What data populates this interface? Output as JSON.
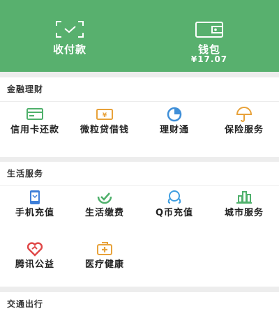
{
  "header": {
    "collect": {
      "label": "收付款",
      "icon": "scan-icon"
    },
    "wallet": {
      "label": "钱包",
      "balance": "¥17.07",
      "icon": "wallet-icon"
    }
  },
  "finance": {
    "title": "金融理财",
    "items": [
      {
        "label": "信用卡还款",
        "icon": "credit-card-icon",
        "color": "#4fb06b"
      },
      {
        "label": "微粒贷借钱",
        "icon": "loan-icon",
        "color": "#e8a23a"
      },
      {
        "label": "理财通",
        "icon": "wealth-icon",
        "color": "#3f8fd8"
      },
      {
        "label": "保险服务",
        "icon": "insurance-icon",
        "color": "#e8a23a"
      }
    ]
  },
  "life": {
    "title": "生活服务",
    "items": [
      {
        "label": "手机充值",
        "icon": "phone-icon",
        "color": "#3f7fd8"
      },
      {
        "label": "生活缴费",
        "icon": "utility-icon",
        "color": "#4fb06b"
      },
      {
        "label": "Q币充值",
        "icon": "qcoin-icon",
        "color": "#3f9ee0"
      },
      {
        "label": "城市服务",
        "icon": "city-icon",
        "color": "#4fb06b"
      },
      {
        "label": "腾讯公益",
        "icon": "charity-icon",
        "color": "#e04848"
      },
      {
        "label": "医疗健康",
        "icon": "health-icon",
        "color": "#e8a23a"
      }
    ]
  },
  "transport": {
    "title": "交通出行"
  }
}
